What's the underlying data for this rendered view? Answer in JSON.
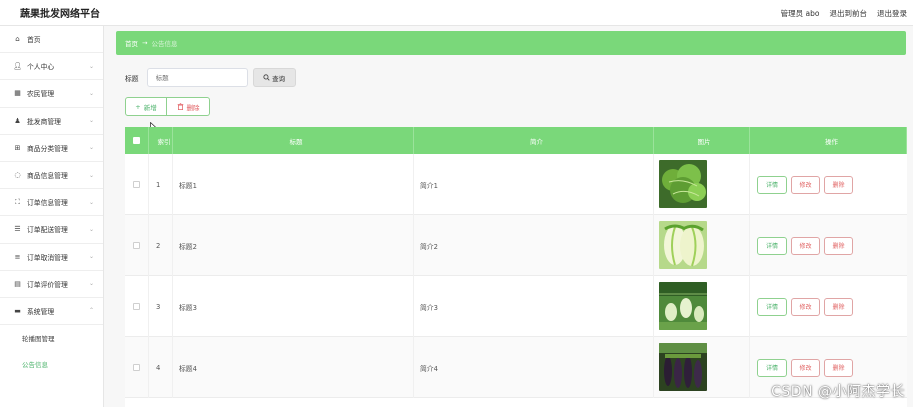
{
  "header": {
    "title": "蔬果批发网络平台",
    "admin": "管理员 abo",
    "back_front": "退出到前台",
    "logout": "退出登录"
  },
  "sidebar": {
    "items": [
      {
        "label": "首页",
        "icon": "home-icon",
        "glyph": "⌂",
        "chev": false
      },
      {
        "label": "个人中心",
        "icon": "user-icon",
        "glyph": "👤︎",
        "chev": true
      },
      {
        "label": "农民管理",
        "icon": "building-icon",
        "glyph": "▦",
        "chev": true
      },
      {
        "label": "批发商管理",
        "icon": "person-icon",
        "glyph": "♟",
        "chev": true
      },
      {
        "label": "商品分类管理",
        "icon": "grid-icon",
        "glyph": "⊞",
        "chev": true
      },
      {
        "label": "商品信息管理",
        "icon": "clock-icon",
        "glyph": "◌",
        "chev": true
      },
      {
        "label": "订单信息管理",
        "icon": "frame-icon",
        "glyph": "⛶",
        "chev": true
      },
      {
        "label": "订单配送管理",
        "icon": "filter-icon",
        "glyph": "☰",
        "chev": true
      },
      {
        "label": "订单取消管理",
        "icon": "list-icon",
        "glyph": "≡",
        "chev": true
      },
      {
        "label": "订单评价管理",
        "icon": "chart-icon",
        "glyph": "▤",
        "chev": true
      },
      {
        "label": "系统管理",
        "icon": "system-icon",
        "glyph": "▬",
        "chev": true,
        "open": true
      }
    ],
    "subitems": [
      {
        "label": "轮播图管理",
        "active": false
      },
      {
        "label": "公告信息",
        "active": true
      }
    ]
  },
  "breadcrumb": {
    "home": "首页",
    "arrow": "→",
    "current": "公告信息"
  },
  "search": {
    "label": "标题",
    "placeholder": "标题",
    "button": "查询"
  },
  "actions": {
    "add": "新增",
    "delete": "删除"
  },
  "table": {
    "headers": [
      "索引",
      "标题",
      "简介",
      "图片",
      "操作"
    ],
    "rows": [
      {
        "index": "1",
        "title": "标题1",
        "intro": "简介1",
        "image": "lettuce"
      },
      {
        "index": "2",
        "title": "标题2",
        "intro": "简介2",
        "image": "cabbage"
      },
      {
        "index": "3",
        "title": "标题3",
        "intro": "简介3",
        "image": "gourd"
      },
      {
        "index": "4",
        "title": "标题4",
        "intro": "简介4",
        "image": "eggplant"
      }
    ],
    "row_buttons": {
      "detail": "详情",
      "edit": "修改",
      "remove": "删除"
    }
  },
  "watermark": "CSDN @小阿杰学长",
  "colors": {
    "accent": "#7ad87a",
    "accent_text": "#4db36c",
    "danger": "#e06060"
  }
}
